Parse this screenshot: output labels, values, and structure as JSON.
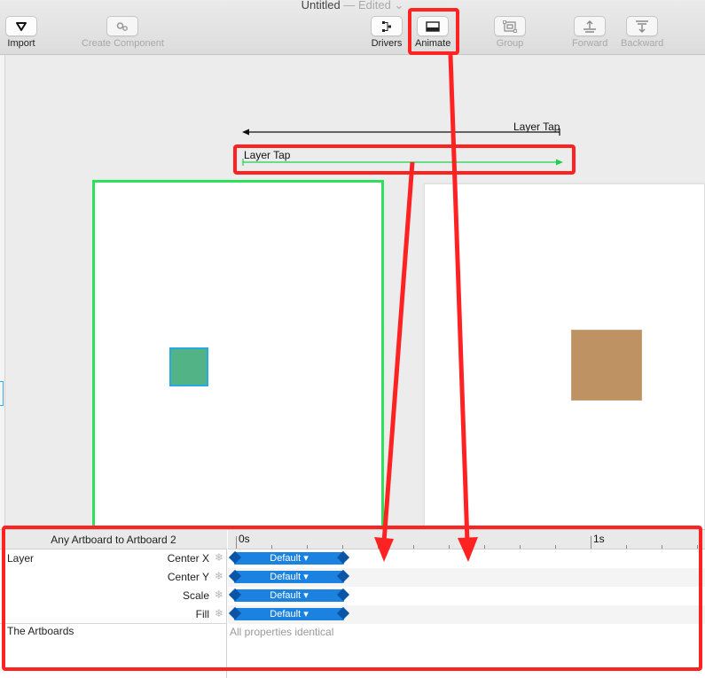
{
  "window": {
    "title": "Untitled",
    "edited": "— Edited ⌄"
  },
  "toolbar": {
    "import": "Import",
    "create_component": "Create Component",
    "drivers": "Drivers",
    "animate": "Animate",
    "group": "Group",
    "forward": "Forward",
    "backward": "Backward"
  },
  "canvas": {
    "connection_back_label": "Layer Tap",
    "connection_forward_label": "Layer Tap",
    "colors": {
      "green_square": "#52b386",
      "brown_square": "#bf9264",
      "selection_green": "#2ee05a",
      "highlight": "#ff2222"
    }
  },
  "timeline": {
    "header": "Any Artboard to Artboard 2",
    "ruler": {
      "start": "0s",
      "end": "1s"
    },
    "layers": [
      {
        "name": "Layer",
        "properties": [
          {
            "name": "Center X",
            "curve": "Default ▾"
          },
          {
            "name": "Center Y",
            "curve": "Default ▾"
          },
          {
            "name": "Scale",
            "curve": "Default ▾"
          },
          {
            "name": "Fill",
            "curve": "Default ▾"
          }
        ]
      },
      {
        "name": "The Artboards",
        "note": "All properties identical"
      }
    ]
  }
}
